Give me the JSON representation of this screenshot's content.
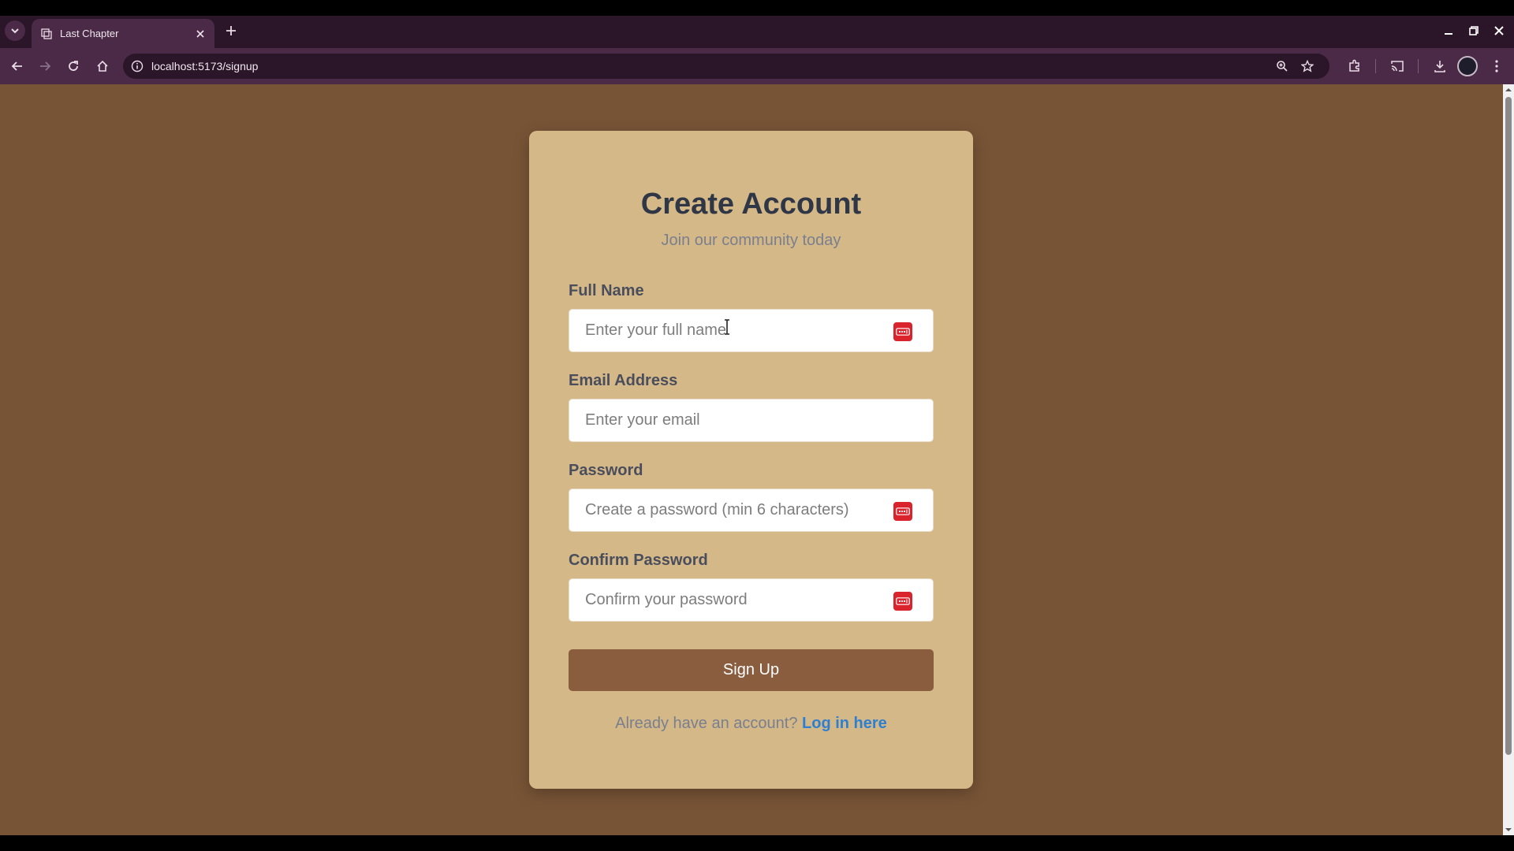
{
  "browser": {
    "tab_title": "Last Chapter",
    "url": "localhost:5173/signup"
  },
  "form": {
    "title": "Create Account",
    "subtitle": "Join our community today",
    "full_name_label": "Full Name",
    "full_name_placeholder": "Enter your full name",
    "full_name_value": "",
    "email_label": "Email Address",
    "email_placeholder": "Enter your email",
    "email_value": "",
    "password_label": "Password",
    "password_placeholder": "Create a password (min 6 characters)",
    "password_value": "",
    "confirm_label": "Confirm Password",
    "confirm_placeholder": "Confirm your password",
    "confirm_value": "",
    "submit_label": "Sign Up",
    "footer_text": "Already have an account?",
    "login_link": "Log in here"
  },
  "colors": {
    "page_bg": "#785436",
    "card_bg": "#d4b888",
    "button_bg": "#8a5d3f",
    "link": "#2f7fd0",
    "password_manager_icon": "#d9232d"
  },
  "icons": {
    "password_manager": "password-manager-icon"
  }
}
